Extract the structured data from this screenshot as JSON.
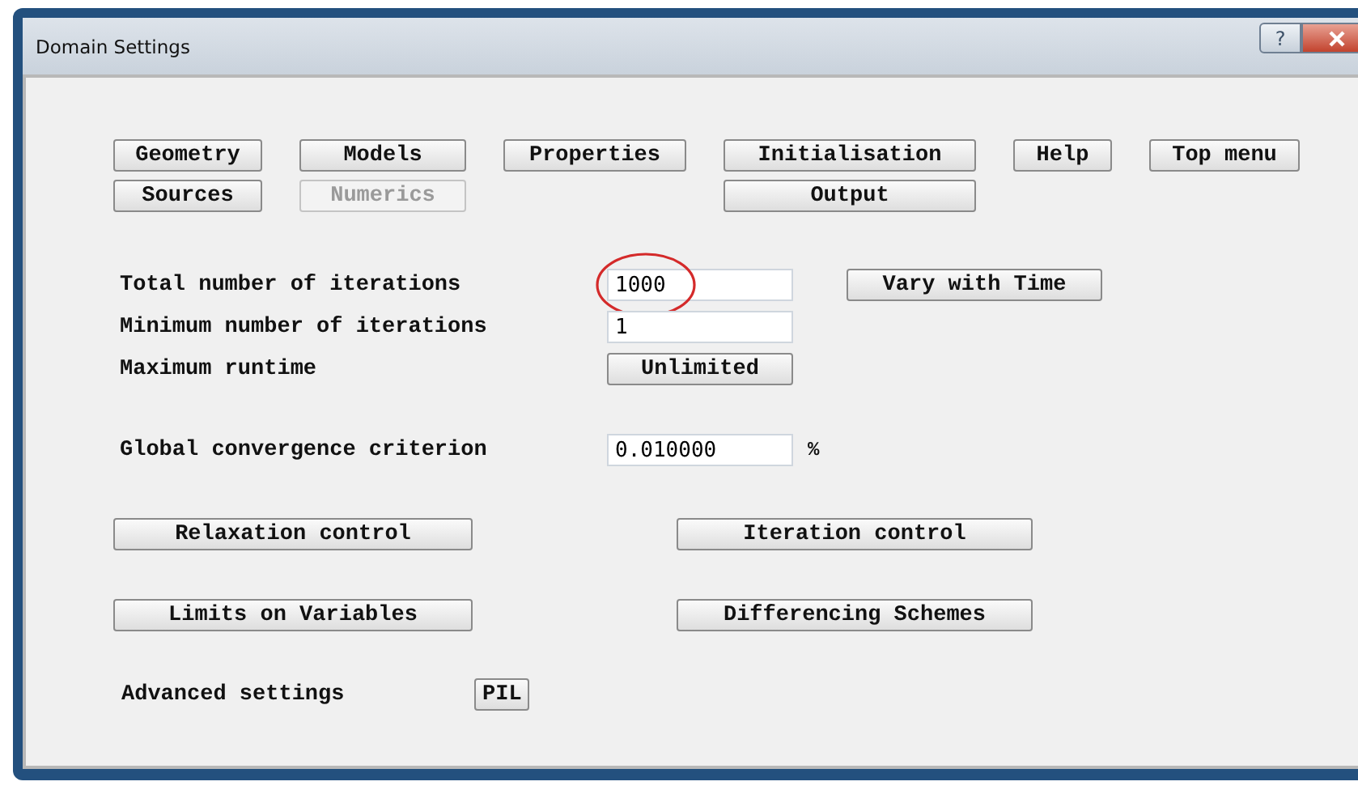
{
  "window": {
    "title": "Domain Settings",
    "help": "?"
  },
  "nav_buttons": [
    {
      "label": "Geometry",
      "disabled": false
    },
    {
      "label": "Models",
      "disabled": false
    },
    {
      "label": "Properties",
      "disabled": false
    },
    {
      "label": "Initialisation",
      "disabled": false
    },
    {
      "label": "Help",
      "disabled": false
    },
    {
      "label": "Top menu",
      "disabled": false
    },
    {
      "label": "Sources",
      "disabled": false
    },
    {
      "label": "Numerics",
      "disabled": true
    },
    {
      "label": "Output",
      "disabled": false
    }
  ],
  "settings": [
    {
      "kind": "field",
      "label": "Total number of iterations",
      "value": "1000",
      "circled": true,
      "action": "Vary with Time"
    },
    {
      "kind": "field",
      "label": "Minimum number of iterations",
      "value": "1",
      "circled": false
    },
    {
      "kind": "button",
      "label": "Maximum runtime",
      "value": "Unlimited"
    },
    {
      "kind": "field",
      "label": "Global convergence criterion",
      "value": "0.010000",
      "circled": false,
      "unit": "%"
    }
  ],
  "control_buttons": [
    "Relaxation control",
    "Iteration control",
    "Limits on Variables",
    "Differencing Schemes"
  ],
  "advanced": {
    "label": "Advanced settings",
    "button": "PIL"
  }
}
